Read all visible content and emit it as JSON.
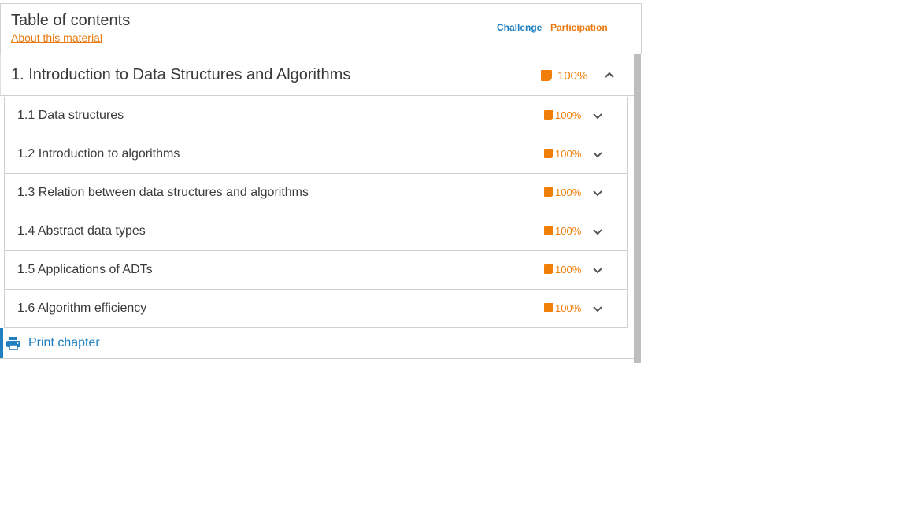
{
  "header": {
    "title": "Table of contents",
    "about_link": "About this material",
    "legend": {
      "challenge": "Challenge",
      "participation": "Participation"
    }
  },
  "chapter": {
    "title": "1. Introduction to Data Structures and Algorithms",
    "progress": "100%",
    "expanded": true
  },
  "sections": [
    {
      "title": "1.1 Data structures",
      "progress": "100%"
    },
    {
      "title": "1.2 Introduction to algorithms",
      "progress": "100%"
    },
    {
      "title": "1.3 Relation between data structures and algorithms",
      "progress": "100%"
    },
    {
      "title": "1.4 Abstract data types",
      "progress": "100%"
    },
    {
      "title": "1.5 Applications of ADTs",
      "progress": "100%"
    },
    {
      "title": "1.6 Algorithm efficiency",
      "progress": "100%"
    }
  ],
  "print": {
    "label": "Print chapter",
    "icon": "printer-icon"
  },
  "colors": {
    "participation": "#f07f09",
    "challenge": "#1e7fc1"
  }
}
